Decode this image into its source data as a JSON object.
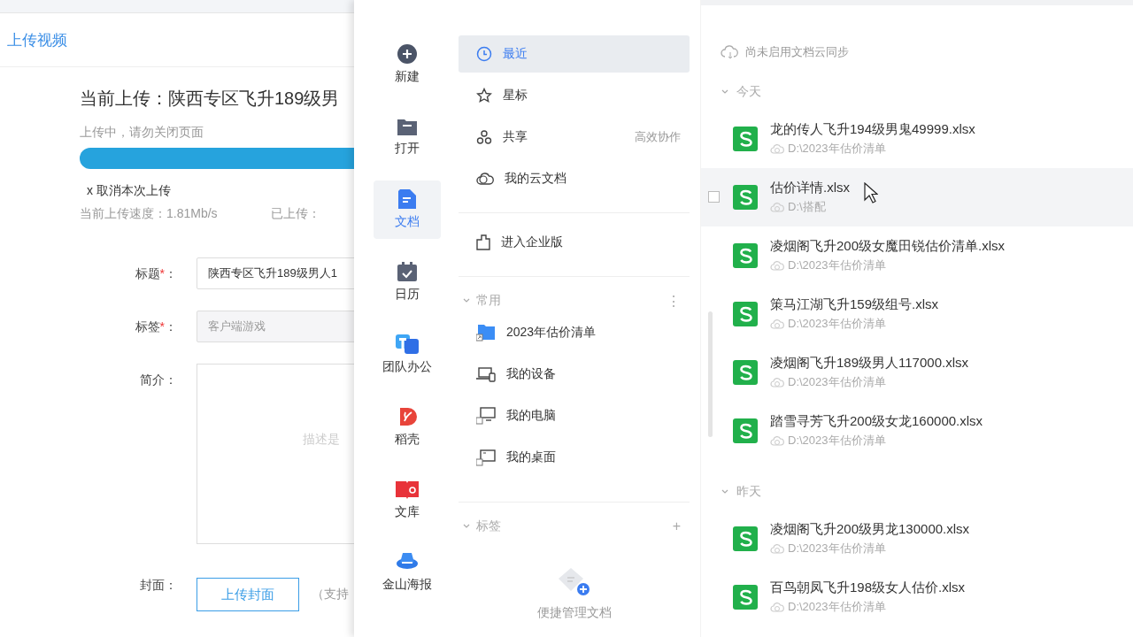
{
  "browser_page": {
    "heading": "上传视频",
    "upload_title": "当前上传：陕西专区飞升189级男",
    "status": "上传中，请勿关闭页面",
    "cancel": "x 取消本次上传",
    "speed": "当前上传速度：1.81Mb/s",
    "uploaded": "已上传：",
    "form": [
      {
        "kind": "input",
        "label": "标题",
        "required_mark": "*",
        "colon": "：",
        "value": "陕西专区飞升189级男人1",
        "disabled": false
      },
      {
        "kind": "input",
        "label": "标签",
        "required_mark": "*",
        "colon": "：",
        "value": "客户端游戏",
        "disabled": true
      },
      {
        "kind": "textarea",
        "label": "简介",
        "colon": "：",
        "placeholder": "描述是"
      },
      {
        "kind": "upload",
        "label": "封面",
        "colon": "：",
        "button": "上传封面",
        "hint": "（支持"
      }
    ]
  },
  "wps": {
    "rail": [
      {
        "kind": "new",
        "label": "新建",
        "selected": false
      },
      {
        "kind": "open",
        "label": "打开",
        "selected": false
      },
      {
        "kind": "docs",
        "label": "文档",
        "selected": true
      },
      {
        "kind": "calendar",
        "label": "日历",
        "selected": false
      },
      {
        "kind": "team",
        "label": "团队办公",
        "selected": false
      },
      {
        "kind": "docer",
        "label": "稻壳",
        "selected": false
      },
      {
        "kind": "library",
        "label": "文库",
        "selected": false
      },
      {
        "kind": "poster",
        "label": "金山海报",
        "selected": false
      }
    ],
    "nav": [
      {
        "kind": "clock",
        "label": "最近",
        "selected": true
      },
      {
        "kind": "star",
        "label": "星标",
        "selected": false
      },
      {
        "kind": "share",
        "label": "共享",
        "note": "高效协作",
        "selected": false
      },
      {
        "kind": "cloud",
        "label": "我的云文档",
        "selected": false
      }
    ],
    "enterprise": {
      "label": "进入企业版"
    },
    "common": {
      "title": "常用",
      "expanded": true,
      "more": "⋮",
      "items": [
        {
          "kind": "folder",
          "label": "2023年估价清单"
        },
        {
          "kind": "device",
          "label": "我的设备"
        },
        {
          "kind": "computer",
          "label": "我的电脑"
        },
        {
          "kind": "desktop",
          "label": "我的桌面"
        }
      ]
    },
    "tags": {
      "title": "标签",
      "expanded": true,
      "add": "+",
      "empty_text": "便捷管理文档"
    },
    "sync_notice": "尚未启用文档云同步",
    "groups": [
      {
        "title": "今天",
        "expanded": true,
        "files": [
          {
            "name": "龙的传人飞升194级男鬼49999.xlsx",
            "path": "D:\\2023年估价清单",
            "hovered": false
          },
          {
            "name": "估价详情.xlsx",
            "path": "D:\\搭配",
            "hovered": true
          },
          {
            "name": "凌烟阁飞升200级女魔田锐估价清单.xlsx",
            "path": "D:\\2023年估价清单",
            "hovered": false
          },
          {
            "name": "策马江湖飞升159级组号.xlsx",
            "path": "D:\\2023年估价清单",
            "hovered": false
          },
          {
            "name": "凌烟阁飞升189级男人117000.xlsx",
            "path": "D:\\2023年估价清单",
            "hovered": false
          },
          {
            "name": "踏雪寻芳飞升200级女龙160000.xlsx",
            "path": "D:\\2023年估价清单",
            "hovered": false
          }
        ]
      },
      {
        "title": "昨天",
        "expanded": true,
        "files": [
          {
            "name": "凌烟阁飞升200级男龙130000.xlsx",
            "path": "D:\\2023年估价清单",
            "hovered": false
          },
          {
            "name": "百鸟朝凤飞升198级女人估价.xlsx",
            "path": "D:\\2023年估价清单",
            "hovered": false
          }
        ]
      }
    ]
  }
}
